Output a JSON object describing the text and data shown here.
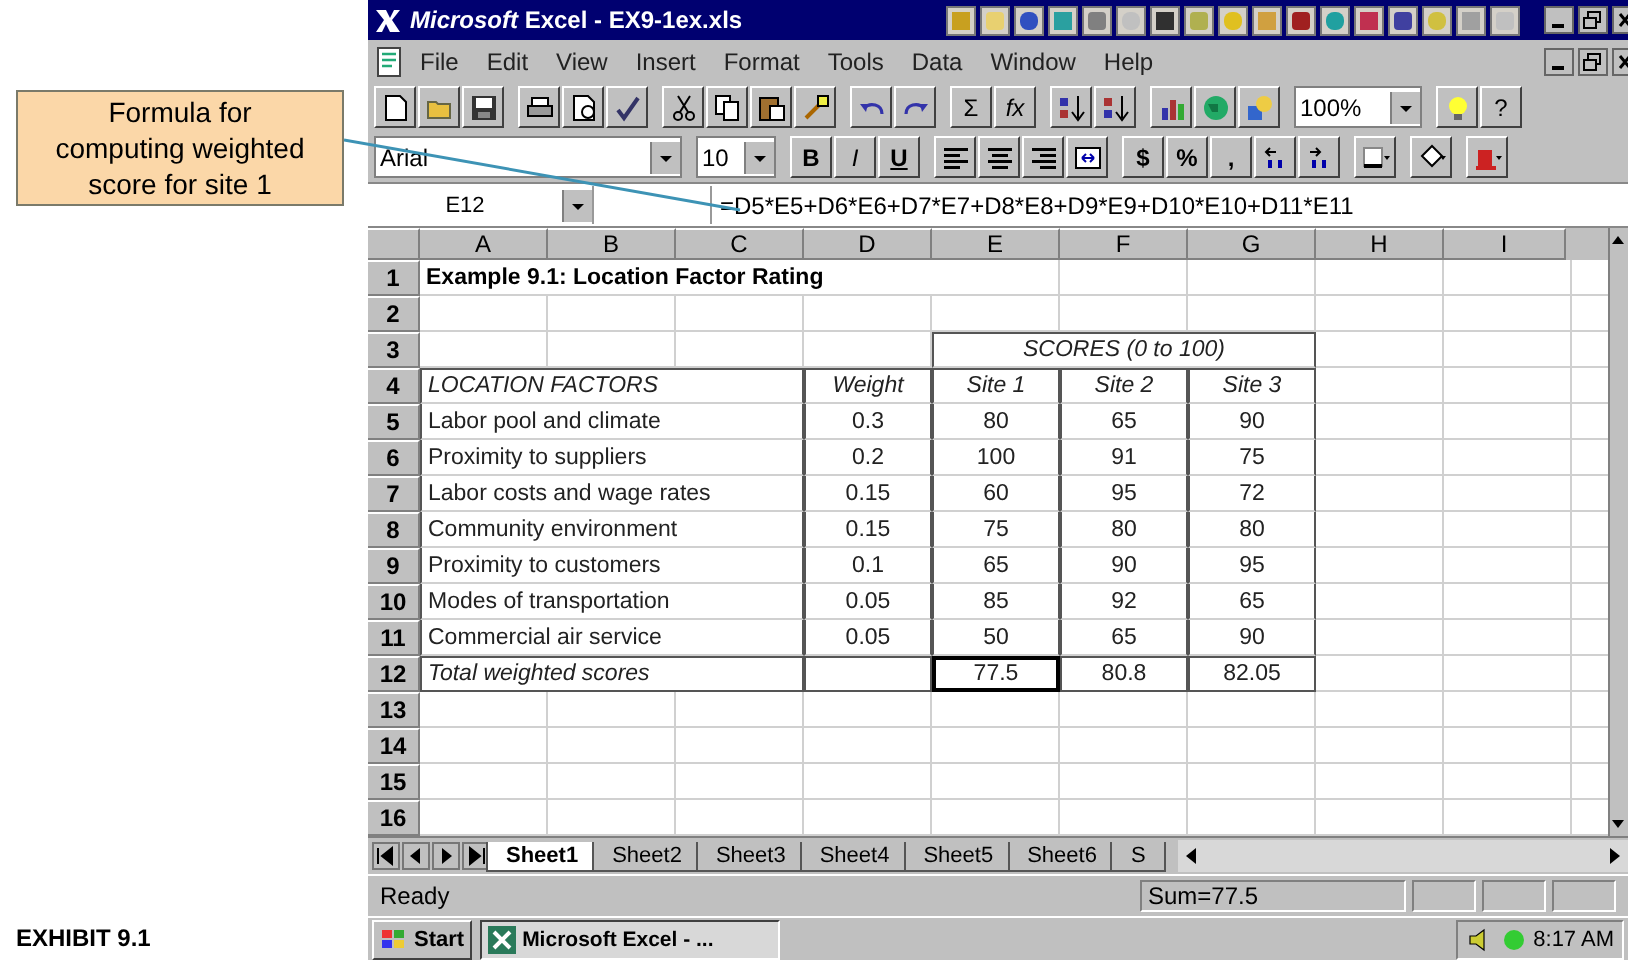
{
  "callout": {
    "text": "Formula for computing weighted score for site 1"
  },
  "caption": "EXHIBIT 9.1",
  "window": {
    "title": "*Microsoft* Excel - EX9-1ex.xls"
  },
  "menu": [
    "File",
    "Edit",
    "View",
    "Insert",
    "Format",
    "Tools",
    "Data",
    "Window",
    "Help"
  ],
  "toolbar": {
    "sum": "Σ",
    "function": "fx",
    "zoom": "100%",
    "help": "?"
  },
  "format_toolbar": {
    "font": "Arial",
    "size": "10",
    "styles": [
      "B",
      "I",
      "U"
    ],
    "number_formats": [
      "$",
      "%",
      ","
    ]
  },
  "formula_bar": {
    "name_box": "E12",
    "formula": "=D5*E5+D6*E6+D7*E7+D8*E8+D9*E9+D10*E10+D11*E11"
  },
  "sheet": {
    "columns": [
      "A",
      "B",
      "C",
      "D",
      "E",
      "F",
      "G",
      "H",
      "I"
    ],
    "row_numbers": [
      "1",
      "2",
      "3",
      "4",
      "5",
      "6",
      "7",
      "8",
      "9",
      "10",
      "11",
      "12",
      "13",
      "14",
      "15",
      "16"
    ],
    "title": "Example 9.1: Location Factor Rating",
    "scores_heading": "SCORES (0 to 100)",
    "header": {
      "factor": "LOCATION FACTORS",
      "weight": "Weight",
      "sites": [
        "Site 1",
        "Site 2",
        "Site 3"
      ]
    },
    "factors": [
      {
        "name": "Labor pool and climate",
        "weight": "0.3",
        "scores": [
          "80",
          "65",
          "90"
        ]
      },
      {
        "name": "Proximity to suppliers",
        "weight": "0.2",
        "scores": [
          "100",
          "91",
          "75"
        ]
      },
      {
        "name": "Labor costs and wage rates",
        "weight": "0.15",
        "scores": [
          "60",
          "95",
          "72"
        ]
      },
      {
        "name": "Community environment",
        "weight": "0.15",
        "scores": [
          "75",
          "80",
          "80"
        ]
      },
      {
        "name": "Proximity to customers",
        "weight": "0.1",
        "scores": [
          "65",
          "90",
          "95"
        ]
      },
      {
        "name": "Modes of transportation",
        "weight": "0.05",
        "scores": [
          "85",
          "92",
          "65"
        ]
      },
      {
        "name": "Commercial air service",
        "weight": "0.05",
        "scores": [
          "50",
          "65",
          "90"
        ]
      }
    ],
    "total": {
      "label": "Total weighted scores",
      "scores": [
        {
          "value": "77.5",
          "selected": true
        },
        {
          "value": "80.8",
          "selected": false
        },
        {
          "value": "82.05",
          "selected": false
        }
      ]
    }
  },
  "sheet_tabs": [
    {
      "label": "Sheet1",
      "selected": true
    },
    {
      "label": "Sheet2",
      "selected": false
    },
    {
      "label": "Sheet3",
      "selected": false
    },
    {
      "label": "Sheet4",
      "selected": false
    },
    {
      "label": "Sheet5",
      "selected": false
    },
    {
      "label": "Sheet6",
      "selected": false
    },
    {
      "label": "S",
      "selected": false
    }
  ],
  "status_bar": {
    "text": "Ready",
    "sum": "Sum=77.5"
  },
  "taskbar": {
    "start": "Start",
    "task": "Microsoft Excel - ...",
    "clock": "8:17 AM"
  }
}
